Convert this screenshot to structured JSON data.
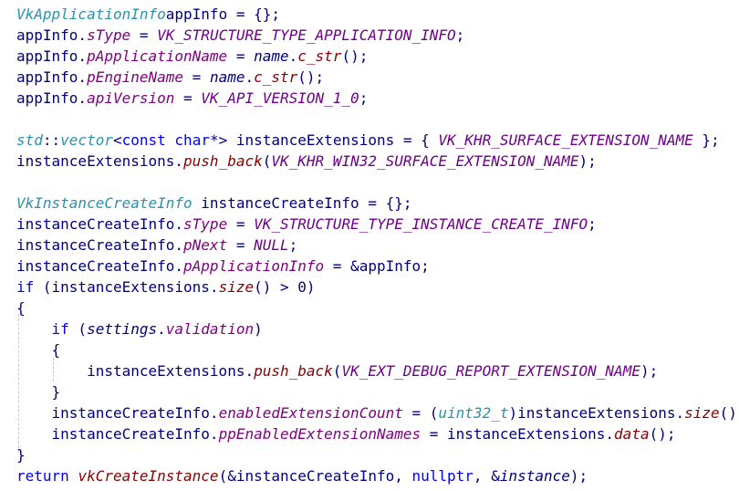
{
  "editor": {
    "colors": {
      "default": "#000080",
      "keyword": "#0000ff",
      "type": "#2b91af",
      "member": "#800080",
      "macro": "#6f008a",
      "function": "#880000"
    },
    "lines": [
      [
        [
          "type",
          "VkApplicationInfo"
        ],
        [
          "",
          "appInfo = {};"
        ]
      ],
      [
        [
          "",
          "appInfo."
        ],
        [
          "member",
          "sType"
        ],
        [
          "",
          " = "
        ],
        [
          "macro",
          "VK_STRUCTURE_TYPE_APPLICATION_INFO"
        ],
        [
          "",
          ";"
        ]
      ],
      [
        [
          "",
          "appInfo."
        ],
        [
          "member",
          "pApplicationName"
        ],
        [
          "",
          " = "
        ],
        [
          "var",
          "name"
        ],
        [
          "",
          "."
        ],
        [
          "func",
          "c_str"
        ],
        [
          "",
          "();"
        ]
      ],
      [
        [
          "",
          "appInfo."
        ],
        [
          "member",
          "pEngineName"
        ],
        [
          "",
          " = "
        ],
        [
          "var",
          "name"
        ],
        [
          "",
          "."
        ],
        [
          "func",
          "c_str"
        ],
        [
          "",
          "();"
        ]
      ],
      [
        [
          "",
          "appInfo."
        ],
        [
          "member",
          "apiVersion"
        ],
        [
          "",
          " = "
        ],
        [
          "macro",
          "VK_API_VERSION_1_0"
        ],
        [
          "",
          ";"
        ]
      ],
      [],
      [
        [
          "type",
          "std"
        ],
        [
          "",
          "::"
        ],
        [
          "type",
          "vector"
        ],
        [
          "",
          "<"
        ],
        [
          "kw",
          "const"
        ],
        [
          "",
          " "
        ],
        [
          "kw",
          "char"
        ],
        [
          "",
          "*> instanceExtensions = { "
        ],
        [
          "macro",
          "VK_KHR_SURFACE_EXTENSION_NAME"
        ],
        [
          "",
          " };"
        ]
      ],
      [
        [
          "",
          "instanceExtensions."
        ],
        [
          "func",
          "push_back"
        ],
        [
          "",
          "("
        ],
        [
          "macro",
          "VK_KHR_WIN32_SURFACE_EXTENSION_NAME"
        ],
        [
          "",
          ");"
        ]
      ],
      [],
      [
        [
          "type",
          "VkInstanceCreateInfo"
        ],
        [
          "",
          " instanceCreateInfo = {};"
        ]
      ],
      [
        [
          "",
          "instanceCreateInfo."
        ],
        [
          "member",
          "sType"
        ],
        [
          "",
          " = "
        ],
        [
          "macro",
          "VK_STRUCTURE_TYPE_INSTANCE_CREATE_INFO"
        ],
        [
          "",
          ";"
        ]
      ],
      [
        [
          "",
          "instanceCreateInfo."
        ],
        [
          "member",
          "pNext"
        ],
        [
          "",
          " = "
        ],
        [
          "macro",
          "NULL"
        ],
        [
          "",
          ";"
        ]
      ],
      [
        [
          "",
          "instanceCreateInfo."
        ],
        [
          "member",
          "pApplicationInfo"
        ],
        [
          "",
          " = &appInfo;"
        ]
      ],
      [
        [
          "kw",
          "if"
        ],
        [
          "",
          " (instanceExtensions."
        ],
        [
          "func",
          "size"
        ],
        [
          "",
          "() > 0)"
        ]
      ],
      [
        [
          "",
          "{"
        ]
      ],
      [
        [
          "",
          "    "
        ],
        [
          "kw",
          "if"
        ],
        [
          "",
          " ("
        ],
        [
          "var",
          "settings"
        ],
        [
          "",
          "."
        ],
        [
          "member",
          "validation"
        ],
        [
          "",
          ")"
        ]
      ],
      [
        [
          "",
          "    {"
        ]
      ],
      [
        [
          "",
          "        instanceExtensions."
        ],
        [
          "func",
          "push_back"
        ],
        [
          "",
          "("
        ],
        [
          "macro",
          "VK_EXT_DEBUG_REPORT_EXTENSION_NAME"
        ],
        [
          "",
          ");"
        ]
      ],
      [
        [
          "",
          "    }"
        ]
      ],
      [
        [
          "",
          "    instanceCreateInfo."
        ],
        [
          "member",
          "enabledExtensionCount"
        ],
        [
          "",
          " = ("
        ],
        [
          "type",
          "uint32_t"
        ],
        [
          "",
          ")instanceExtensions."
        ],
        [
          "func",
          "size"
        ],
        [
          "",
          "()"
        ]
      ],
      [
        [
          "",
          "    instanceCreateInfo."
        ],
        [
          "member",
          "ppEnabledExtensionNames"
        ],
        [
          "",
          " = instanceExtensions."
        ],
        [
          "func",
          "data"
        ],
        [
          "",
          "();"
        ]
      ],
      [
        [
          "",
          "}"
        ]
      ],
      [
        [
          "kw",
          "return"
        ],
        [
          "",
          " "
        ],
        [
          "func",
          "vkCreateInstance"
        ],
        [
          "",
          "(&instanceCreateInfo, "
        ],
        [
          "kw",
          "nullptr"
        ],
        [
          "",
          ", &"
        ],
        [
          "var",
          "instance"
        ],
        [
          "",
          ");"
        ]
      ]
    ]
  }
}
